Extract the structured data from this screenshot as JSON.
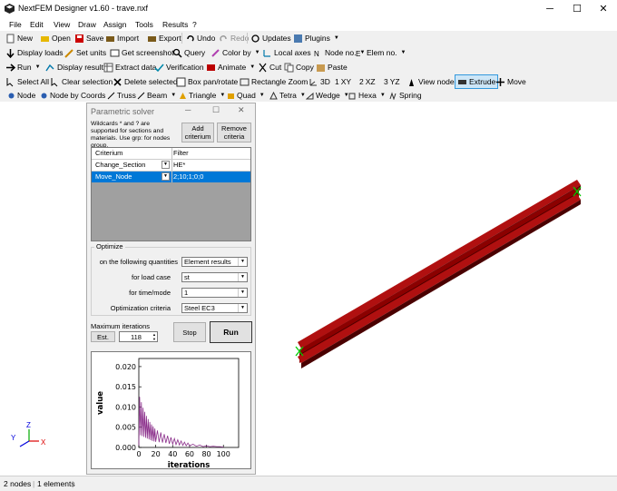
{
  "window": {
    "title": "NextFEM Designer v1.60 - trave.nxf",
    "minimize": "─",
    "maximize": "☐",
    "close": "✕"
  },
  "menu": [
    "File",
    "Edit",
    "View",
    "Draw",
    "Assign",
    "Tools",
    "Results",
    "?"
  ],
  "toolbar": {
    "new": "New",
    "open": "Open",
    "save": "Save",
    "import": "Import",
    "export": "Export",
    "undo": "Undo",
    "redo": "Redo",
    "updates": "Updates",
    "plugins": "Plugins",
    "display_loads": "Display loads",
    "set_units": "Set units",
    "get_screenshot": "Get screenshot",
    "query": "Query",
    "color_by": "Color by",
    "local_axes": "Local axes",
    "node_no": "Node no.",
    "elem_no": "Elem no.",
    "run": "Run",
    "display_results": "Display results",
    "extract_data": "Extract data",
    "verification": "Verification",
    "animate": "Animate",
    "cut": "Cut",
    "copy": "Copy",
    "paste": "Paste",
    "select_all": "Select All",
    "clear_selection": "Clear selection",
    "delete_selected": "Delete selected",
    "box_pan_rotate": "Box pan/rotate",
    "rectangle_zoom": "Rectangle Zoom",
    "view_3d": "3D",
    "view_xy": "XY",
    "view_xz": "XZ",
    "view_yz": "YZ",
    "view_nodes": "View nodes",
    "extrude": "Extrude",
    "move": "Move",
    "node": "Node",
    "node_by_coords": "Node by Coords",
    "truss": "Truss",
    "beam": "Beam",
    "triangle": "Triangle",
    "quad": "Quad",
    "tetra": "Tetra",
    "wedge": "Wedge",
    "hexa": "Hexa",
    "spring": "Spring",
    "num1": "1",
    "num2": "2",
    "num3": "3"
  },
  "panel": {
    "title": "Parametric solver",
    "help": "Wildcards * and ? are supported for sections and materials. Use grp: for nodes group.",
    "add_criterium": "Add criterium",
    "remove_criteria": "Remove criteria",
    "grid_headers": [
      "Criterium",
      "Filter"
    ],
    "grid_rows": [
      {
        "criterium": "Change_Section",
        "filter": "HE*"
      },
      {
        "criterium": "Move_Node",
        "filter": "2;10;1;0;0"
      }
    ],
    "optimize": {
      "label": "Optimize",
      "quantities_label": "on  the following quantities",
      "quantities_value": "Element results",
      "loadcase_label": "for load case",
      "loadcase_value": "st",
      "time_label": "for time/mode",
      "time_value": "1",
      "criteria_label": "Optimization criteria",
      "criteria_value": "Steel EC3"
    },
    "max_iter_label": "Maximum iterations",
    "est_label": "Est.",
    "max_iter_value": "118",
    "stop_label": "Stop",
    "run_label": "Run"
  },
  "chart_data": {
    "type": "line",
    "xlabel": "iterations",
    "ylabel": "value",
    "xlim": [
      0,
      118
    ],
    "ylim": [
      0,
      0.022
    ],
    "xticks": [
      0,
      20,
      40,
      60,
      80,
      100
    ],
    "yticks": [
      0.0,
      0.005,
      0.01,
      0.015,
      0.02
    ],
    "ytick_labels": [
      "0.000",
      "0.005",
      "0.010",
      "0.015",
      "0.020"
    ],
    "color": "#8b2f8b",
    "series": [
      {
        "x": [
          0,
          1,
          2,
          3,
          4,
          5,
          6,
          7,
          8,
          9,
          10,
          11,
          12,
          13,
          14,
          15,
          16,
          17,
          18,
          19,
          20,
          22,
          24,
          26,
          28,
          30,
          32,
          34,
          36,
          38,
          40,
          42,
          44,
          46,
          48,
          50,
          52,
          54,
          56,
          58,
          60,
          64,
          68,
          72,
          76,
          80,
          84,
          88,
          92,
          96,
          100
        ],
        "values": [
          0.0005,
          0.0125,
          0.003,
          0.0112,
          0.0028,
          0.0098,
          0.0026,
          0.0088,
          0.0024,
          0.0078,
          0.0022,
          0.007,
          0.002,
          0.0063,
          0.0018,
          0.0057,
          0.0016,
          0.0052,
          0.0015,
          0.0047,
          0.0014,
          0.0042,
          0.0013,
          0.0037,
          0.0012,
          0.0033,
          0.0011,
          0.0029,
          0.0009,
          0.0025,
          0.0008,
          0.0022,
          0.0007,
          0.0019,
          0.0006,
          0.0016,
          0.0005,
          0.0013,
          0.0004,
          0.0011,
          0.0004,
          0.0008,
          0.0003,
          0.0006,
          0.0002,
          0.0004,
          0.0002,
          0.0003,
          0.0002,
          0.0002,
          0.0001
        ]
      }
    ]
  },
  "status": {
    "nodes": "2 nodes",
    "elements": "1 elements"
  },
  "axes_triad": {
    "x": "X",
    "y": "Y",
    "z": "Z"
  },
  "colors": {
    "beam": "#8b0000",
    "node_marker": "#00cc00",
    "highlight_row": "#0078d7",
    "plot_line": "#8b2f8b"
  }
}
